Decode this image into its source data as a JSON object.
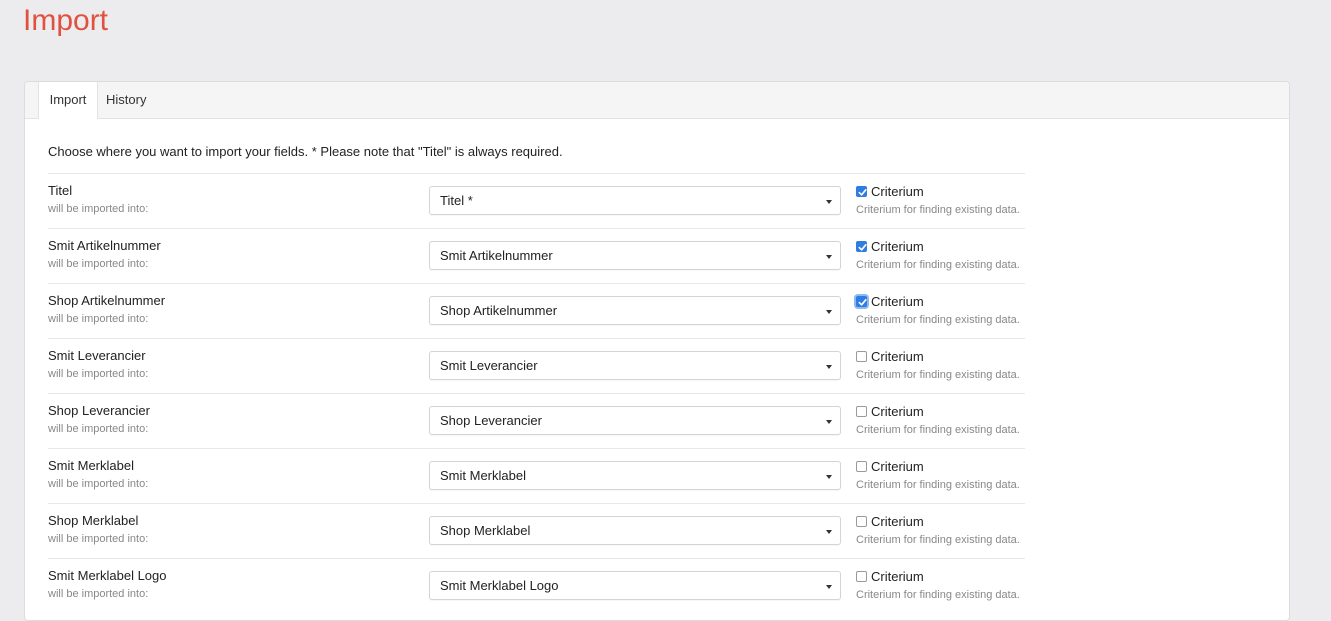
{
  "page": {
    "title": "Import"
  },
  "tabs": [
    {
      "label": "Import",
      "active": true
    },
    {
      "label": "History",
      "active": false
    }
  ],
  "intro": "Choose where you want to import your fields. * Please note that \"Titel\" is always required.",
  "field_hint": "will be imported into:",
  "criterium_label": "Criterium",
  "criterium_help": "Criterium for finding existing data.",
  "rows": [
    {
      "name": "Titel",
      "selected": "Titel *",
      "criterium": true
    },
    {
      "name": "Smit Artikelnummer",
      "selected": "Smit Artikelnummer",
      "criterium": true
    },
    {
      "name": "Shop Artikelnummer",
      "selected": "Shop Artikelnummer",
      "criterium": true,
      "focused": true
    },
    {
      "name": "Smit Leverancier",
      "selected": "Smit Leverancier",
      "criterium": false
    },
    {
      "name": "Shop Leverancier",
      "selected": "Shop Leverancier",
      "criterium": false
    },
    {
      "name": "Smit Merklabel",
      "selected": "Smit Merklabel",
      "criterium": false
    },
    {
      "name": "Shop Merklabel",
      "selected": "Shop Merklabel",
      "criterium": false
    },
    {
      "name": "Smit Merklabel Logo",
      "selected": "Smit Merklabel Logo",
      "criterium": false
    }
  ],
  "colors": {
    "title": "#e0523f",
    "check": "#2f7de1"
  }
}
